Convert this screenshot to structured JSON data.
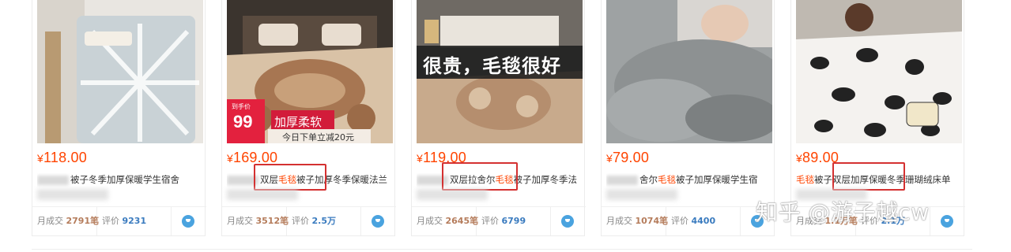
{
  "currency": "¥",
  "sales_label": "月成交",
  "reviews_label": "评价",
  "watermark": "知乎 @游子越cw",
  "products": [
    {
      "price": "118.00",
      "title_parts": [
        {
          "t": "被子冬季加厚保暖学生宿舍",
          "hl": false
        }
      ],
      "sales": "2791笔",
      "reviews": "9231",
      "image": "light-blanket-on-chair"
    },
    {
      "price": "169.00",
      "title_parts": [
        {
          "t": "双层",
          "hl": false
        },
        {
          "t": "毛毯",
          "hl": true
        },
        {
          "t": "被子加厚冬季保暖法兰",
          "hl": false
        }
      ],
      "sales": "3512笔",
      "reviews": "2.5万",
      "image": "floral-blanket-bed",
      "badge_top": "到手价",
      "badge_price": "99",
      "badge_text": "加厚柔软",
      "badge_sub": "今日下单立减20元"
    },
    {
      "price": "119.00",
      "title_parts": [
        {
          "t": "双层拉舍尔",
          "hl": false
        },
        {
          "t": "毛毯",
          "hl": true
        },
        {
          "t": "被子加厚冬季法",
          "hl": false
        }
      ],
      "sales": "2645笔",
      "reviews": "6799",
      "image": "flower-blanket-bed",
      "caption": "很贵，毛毯很好"
    },
    {
      "price": "79.00",
      "title_parts": [
        {
          "t": "舍尔",
          "hl": false
        },
        {
          "t": "毛毯",
          "hl": true
        },
        {
          "t": "被子加厚保暖学生宿",
          "hl": false
        }
      ],
      "sales": "1074笔",
      "reviews": "4400",
      "image": "grey-plush-blanket"
    },
    {
      "price": "89.00",
      "title_parts": [
        {
          "t": "毛毯",
          "hl": true
        },
        {
          "t": "被子双层加厚保暖冬季珊瑚绒床单",
          "hl": false
        }
      ],
      "sales": "1.1万笔",
      "reviews": "2.1万",
      "image": "cow-print-blanket"
    }
  ],
  "colors": {
    "price": "#ff4400",
    "highlight_box": "#d43131",
    "sales_value": "#b57c5b",
    "review_value": "#3a7bbf"
  }
}
